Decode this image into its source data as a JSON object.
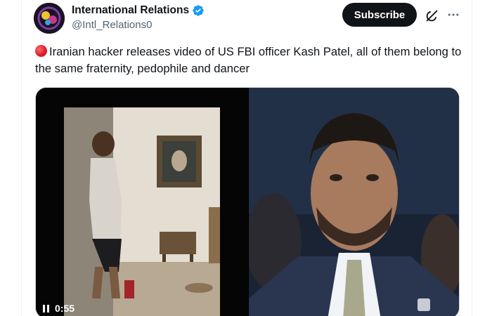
{
  "author": {
    "display_name": "International Relations",
    "handle": "@Intl_Relations0",
    "verified": true,
    "avatar_icon": "avatar-image"
  },
  "actions": {
    "subscribe_label": "Subscribe",
    "grok_icon": "grok-icon",
    "more_icon": "more-horizontal-icon"
  },
  "tweet": {
    "text": "Iranian hacker releases video of US FBI officer Kash Patel, all of them belong to the same fraternity, pedophile and dancer",
    "leading_emoji": "red-circle-icon"
  },
  "media": {
    "video_time": "0:55",
    "pause_icon": "pause-icon"
  },
  "colors": {
    "primary_text": "#0f1419",
    "secondary_text": "#536471",
    "verified_blue": "#1d9bf0",
    "button_bg": "#0f1419"
  }
}
